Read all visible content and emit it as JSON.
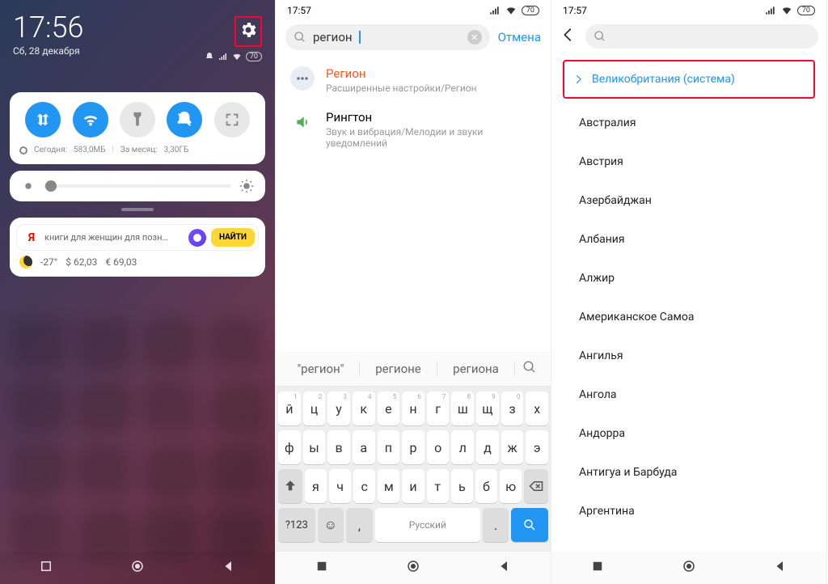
{
  "p1": {
    "time": "17:56",
    "date": "Сб, 28 декабря",
    "battery": "70",
    "usage_today_label": "Сегодня:",
    "usage_today": "583,0МБ",
    "usage_month_label": "За месяц:",
    "usage_month": "3,30ГБ",
    "search_hint": "книги для женщин для позн…",
    "find_label": "НАЙТИ",
    "temp": "-27°",
    "usd": "$ 62,03",
    "eur": "€ 69,03"
  },
  "p2": {
    "time": "17:57",
    "battery": "70",
    "search_value": "регион",
    "cancel": "Отмена",
    "result1_title": "Регион",
    "result1_path": "Расширенные настройки/Регион",
    "result2_title": "Рингтон",
    "result2_path": "Звук и вибрация/Мелодии и звуки уведомлений",
    "suggestions": [
      "\"регион\"",
      "регионе",
      "региона"
    ],
    "kb_row1": [
      "й",
      "ц",
      "у",
      "к",
      "е",
      "н",
      "г",
      "ш",
      "щ",
      "з",
      "х"
    ],
    "kb_row1_sup": [
      "1",
      "2",
      "3",
      "4",
      "5",
      "6",
      "7",
      "8",
      "9",
      "0",
      ""
    ],
    "kb_row2": [
      "ф",
      "ы",
      "в",
      "а",
      "п",
      "р",
      "о",
      "л",
      "д",
      "ж",
      "э"
    ],
    "kb_row3": [
      "я",
      "ч",
      "с",
      "м",
      "и",
      "т",
      "ь",
      "б",
      "ю"
    ],
    "kb_lang": "Русский",
    "kb_num": "?123"
  },
  "p3": {
    "time": "17:57",
    "battery": "70",
    "selected": "Великобритания (система)",
    "regions": [
      "Австралия",
      "Австрия",
      "Азербайджан",
      "Албания",
      "Алжир",
      "Американское Самоа",
      "Ангилья",
      "Ангола",
      "Андорра",
      "Антигуа и Барбуда",
      "Аргентина"
    ]
  }
}
